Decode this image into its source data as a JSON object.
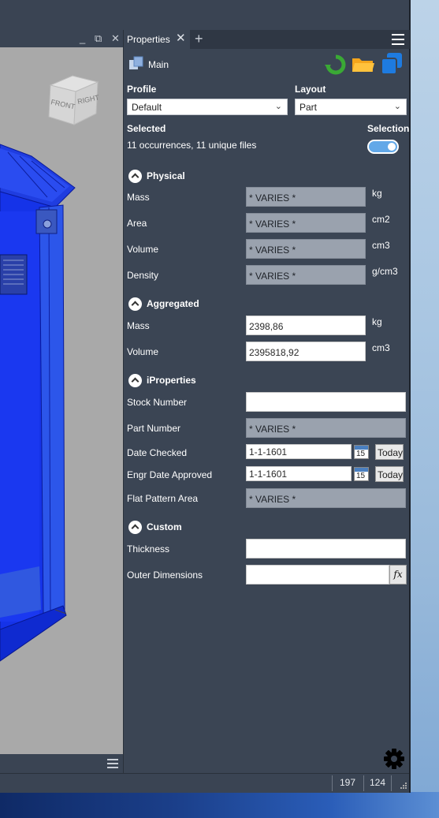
{
  "viewport": {
    "viewcube": {
      "front_label": "FRONT",
      "right_label": "RIGHT"
    },
    "controls": {
      "minimize": "_",
      "restore": "⧉",
      "close": "✕"
    }
  },
  "status_bar": {
    "value1": "197",
    "value2": "124"
  },
  "panel": {
    "tab": {
      "label": "Properties",
      "close": "✕",
      "add": "+"
    },
    "header": {
      "title": "Main"
    },
    "profile": {
      "label": "Profile",
      "value": "Default"
    },
    "layout": {
      "label": "Layout",
      "value": "Part"
    },
    "selected": {
      "label": "Selected",
      "value": "11 occurrences, 11 unique files"
    },
    "selection": {
      "label": "Selection",
      "on": true
    },
    "physical": {
      "title": "Physical",
      "rows": [
        {
          "label": "Mass",
          "value": "* VARIES *",
          "unit": "kg"
        },
        {
          "label": "Area",
          "value": "* VARIES *",
          "unit": "cm2"
        },
        {
          "label": "Volume",
          "value": "* VARIES *",
          "unit": "cm3"
        },
        {
          "label": "Density",
          "value": "* VARIES *",
          "unit": "g/cm3"
        }
      ]
    },
    "aggregated": {
      "title": "Aggregated",
      "rows": [
        {
          "label": "Mass",
          "value": "2398,86",
          "unit": "kg"
        },
        {
          "label": "Volume",
          "value": "2395818,92",
          "unit": "cm3"
        }
      ]
    },
    "iproperties": {
      "title": "iProperties",
      "stock_number": {
        "label": "Stock Number",
        "value": ""
      },
      "part_number": {
        "label": "Part Number",
        "value": "* VARIES *"
      },
      "date_checked": {
        "label": "Date Checked",
        "value": "1-1-1601",
        "cal": "15",
        "today": "Today"
      },
      "engr_date": {
        "label": "Engr Date Approved",
        "value": "1-1-1601",
        "cal": "15",
        "today": "Today"
      },
      "flat_pattern": {
        "label": "Flat Pattern Area",
        "value": "* VARIES *"
      }
    },
    "custom": {
      "title": "Custom",
      "thickness": {
        "label": "Thickness",
        "value": ""
      },
      "outer_dimensions": {
        "label": "Outer Dimensions",
        "value": "",
        "fx": "fx"
      }
    }
  },
  "colors": {
    "panel_bg": "#3b4554",
    "accent_blue": "#62a8e8",
    "refresh_green": "#3aa935",
    "folder_orange": "#f4a51c",
    "copy_blue": "#1e7be0"
  }
}
